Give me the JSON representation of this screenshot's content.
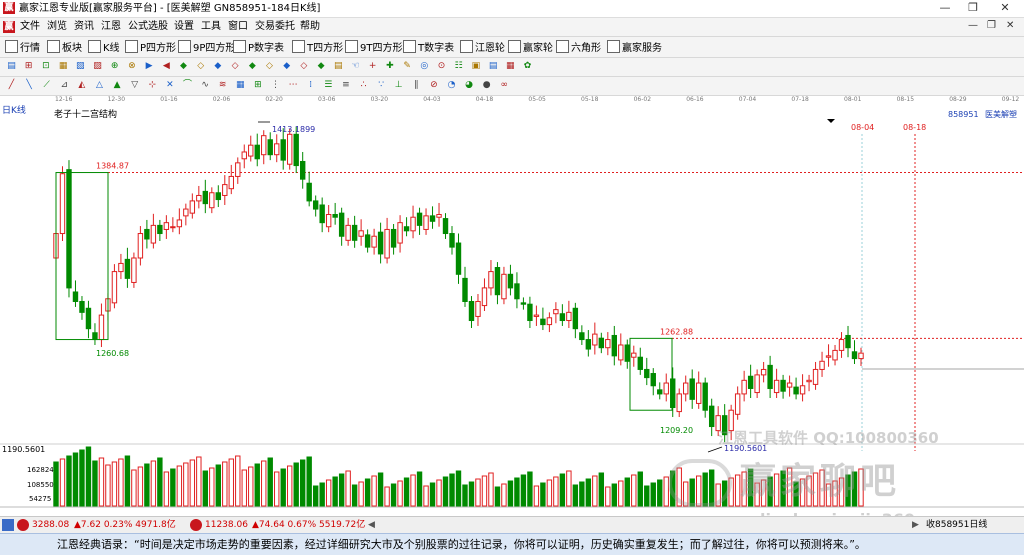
{
  "window": {
    "title": "赢家江恩专业版[赢家服务平台] - [医美解塑  GN858951-184日K线]",
    "controls": [
      "—",
      "❐",
      "✕"
    ]
  },
  "menu": {
    "items": [
      "文件",
      "浏览",
      "资讯",
      "江恩",
      "公式选股",
      "设置",
      "工具",
      "窗口",
      "交易委托",
      "帮助"
    ],
    "mdi_controls": [
      "—",
      "❐",
      "✕"
    ]
  },
  "toolbar": {
    "items": [
      {
        "label": "行情",
        "icon": "grid-icon"
      },
      {
        "label": "板块",
        "icon": "blocks-icon"
      },
      {
        "label": "K线",
        "icon": "kline-icon"
      },
      {
        "label": "P四方形",
        "icon": "p-square-icon"
      },
      {
        "label": "9P四方形",
        "icon": "9p-square-icon"
      },
      {
        "label": "P数字表",
        "icon": "p-number-table-icon"
      },
      {
        "label": "T四方形",
        "icon": "t-square-icon"
      },
      {
        "label": "9T四方形",
        "icon": "9t-square-icon"
      },
      {
        "label": "T数字表",
        "icon": "t-number-table-icon"
      },
      {
        "label": "江恩轮",
        "icon": "gann-wheel-icon"
      },
      {
        "label": "赢家轮",
        "icon": "winner-wheel-icon"
      },
      {
        "label": "六角形",
        "icon": "hexagon-icon"
      },
      {
        "label": "赢家服务",
        "icon": "service-icon"
      }
    ]
  },
  "chart": {
    "panel_label": "日K线",
    "title": "老子十二宫结构",
    "code_name": "858951",
    "name": "医美解塑",
    "colors": {
      "up": "#e02020",
      "down": "#008a00",
      "level": "#e02020",
      "box": "#008a00"
    },
    "date_axis": [
      "12-16",
      "12-30",
      "01-16",
      "02-06",
      "02-20",
      "03-06",
      "03-20",
      "04-03",
      "04-18",
      "05-05",
      "05-18",
      "06-02",
      "06-16",
      "07-04",
      "07-18",
      "08-01",
      "08-15",
      "08-29",
      "09-12"
    ],
    "future_dates": [
      "08-04",
      "08-18"
    ],
    "levels": [
      {
        "value": "1384.87",
        "price": 1384.87
      },
      {
        "value": "1262.88",
        "price": 1262.88
      }
    ],
    "box_labels": {
      "low1": "1260.68",
      "low2": "1209.20"
    },
    "peak_label": "1413.1899",
    "low_label": "1190.5601",
    "volume_axis": [
      "1190.5601",
      "162824",
      "108550",
      "54275"
    ],
    "watermark1": "江恩工具软件 QQ:100800360",
    "watermark2": "赢家聊吧",
    "watermark3": "liaoba.yingjia360.com"
  },
  "chart_data": {
    "type": "candlestick",
    "ylim": [
      1180,
      1425
    ],
    "closes": [
      1340,
      1384,
      1300,
      1290,
      1282,
      1270,
      1262,
      1280,
      1292,
      1312,
      1318,
      1307,
      1322,
      1340,
      1336,
      1346,
      1340,
      1348,
      1345,
      1350,
      1358,
      1364,
      1368,
      1362,
      1370,
      1365,
      1376,
      1382,
      1392,
      1400,
      1405,
      1395,
      1412,
      1398,
      1406,
      1394,
      1413,
      1390,
      1380,
      1364,
      1358,
      1348,
      1354,
      1352,
      1338,
      1346,
      1335,
      1342,
      1330,
      1338,
      1325,
      1343,
      1330,
      1348,
      1342,
      1352,
      1346,
      1353,
      1349,
      1354,
      1340,
      1330,
      1310,
      1290,
      1276,
      1290,
      1300,
      1312,
      1295,
      1310,
      1300,
      1292,
      1288,
      1276,
      1280,
      1273,
      1278,
      1284,
      1276,
      1282,
      1270,
      1262,
      1255,
      1266,
      1256,
      1262,
      1250,
      1258,
      1246,
      1252,
      1240,
      1234,
      1228,
      1222,
      1230,
      1212,
      1222,
      1230,
      1218,
      1230,
      1210,
      1198,
      1206,
      1192,
      1210,
      1222,
      1232,
      1226,
      1236,
      1240,
      1226,
      1232,
      1224,
      1230,
      1222,
      1228,
      1232,
      1240,
      1246,
      1250,
      1254,
      1262,
      1256,
      1248,
      1252
    ]
  },
  "status": {
    "idx1": "3288.08",
    "idx1_chg": "▲7.62 0.23% 4971.8亿",
    "idx2": "11238.06",
    "idx2_chg": "▲74.64 0.67% 5519.72亿",
    "right": "收858951日线"
  },
  "quote": "江恩经典语录：“时间是决定市场走势的重要因素，经过详细研究大市及个别股票的过往记录，你将可以证明，历史确实重复发生；而了解过往，你将可以预测将来。”。"
}
